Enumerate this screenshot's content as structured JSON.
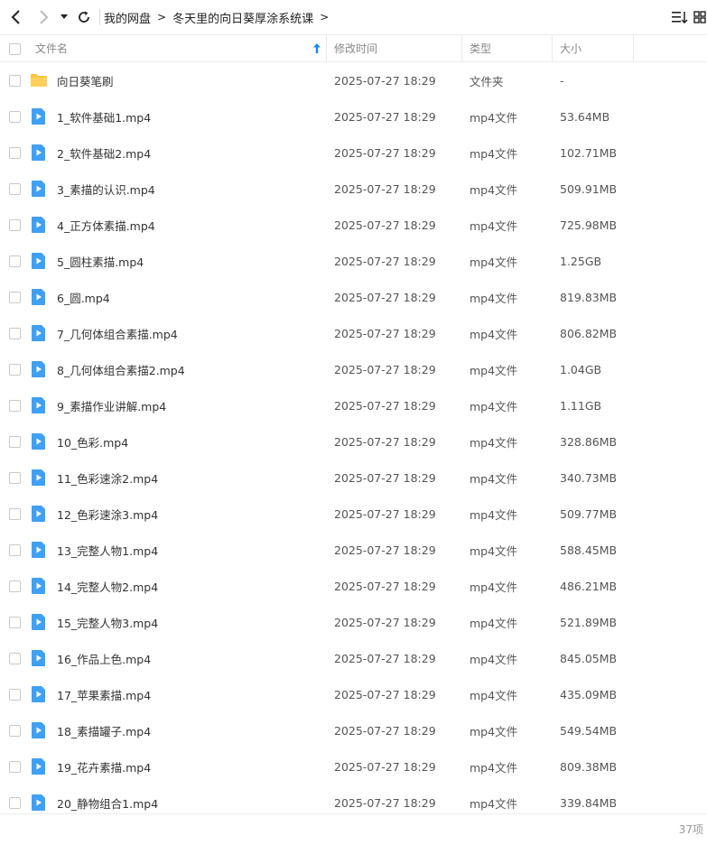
{
  "toolbar": {
    "breadcrumb": [
      "我的网盘",
      "冬天里的向日葵厚涂系统课"
    ]
  },
  "header": {
    "name": "文件名",
    "modified": "修改时间",
    "type": "类型",
    "size": "大小"
  },
  "files": [
    {
      "name": "向日葵笔刷",
      "date": "2025-07-27 18:29",
      "type": "文件夹",
      "size": "-",
      "kind": "folder"
    },
    {
      "name": "1_软件基础1.mp4",
      "date": "2025-07-27 18:29",
      "type": "mp4文件",
      "size": "53.64MB",
      "kind": "video"
    },
    {
      "name": "2_软件基础2.mp4",
      "date": "2025-07-27 18:29",
      "type": "mp4文件",
      "size": "102.71MB",
      "kind": "video"
    },
    {
      "name": "3_素描的认识.mp4",
      "date": "2025-07-27 18:29",
      "type": "mp4文件",
      "size": "509.91MB",
      "kind": "video"
    },
    {
      "name": "4_正方体素描.mp4",
      "date": "2025-07-27 18:29",
      "type": "mp4文件",
      "size": "725.98MB",
      "kind": "video"
    },
    {
      "name": "5_圆柱素描.mp4",
      "date": "2025-07-27 18:29",
      "type": "mp4文件",
      "size": "1.25GB",
      "kind": "video"
    },
    {
      "name": "6_圆.mp4",
      "date": "2025-07-27 18:29",
      "type": "mp4文件",
      "size": "819.83MB",
      "kind": "video"
    },
    {
      "name": "7_几何体组合素描.mp4",
      "date": "2025-07-27 18:29",
      "type": "mp4文件",
      "size": "806.82MB",
      "kind": "video"
    },
    {
      "name": "8_几何体组合素描2.mp4",
      "date": "2025-07-27 18:29",
      "type": "mp4文件",
      "size": "1.04GB",
      "kind": "video"
    },
    {
      "name": "9_素描作业讲解.mp4",
      "date": "2025-07-27 18:29",
      "type": "mp4文件",
      "size": "1.11GB",
      "kind": "video"
    },
    {
      "name": "10_色彩.mp4",
      "date": "2025-07-27 18:29",
      "type": "mp4文件",
      "size": "328.86MB",
      "kind": "video"
    },
    {
      "name": "11_色彩速涂2.mp4",
      "date": "2025-07-27 18:29",
      "type": "mp4文件",
      "size": "340.73MB",
      "kind": "video"
    },
    {
      "name": "12_色彩速涂3.mp4",
      "date": "2025-07-27 18:29",
      "type": "mp4文件",
      "size": "509.77MB",
      "kind": "video"
    },
    {
      "name": "13_完整人物1.mp4",
      "date": "2025-07-27 18:29",
      "type": "mp4文件",
      "size": "588.45MB",
      "kind": "video"
    },
    {
      "name": "14_完整人物2.mp4",
      "date": "2025-07-27 18:29",
      "type": "mp4文件",
      "size": "486.21MB",
      "kind": "video"
    },
    {
      "name": "15_完整人物3.mp4",
      "date": "2025-07-27 18:29",
      "type": "mp4文件",
      "size": "521.89MB",
      "kind": "video"
    },
    {
      "name": "16_作品上色.mp4",
      "date": "2025-07-27 18:29",
      "type": "mp4文件",
      "size": "845.05MB",
      "kind": "video"
    },
    {
      "name": "17_苹果素描.mp4",
      "date": "2025-07-27 18:29",
      "type": "mp4文件",
      "size": "435.09MB",
      "kind": "video"
    },
    {
      "name": "18_素描罐子.mp4",
      "date": "2025-07-27 18:29",
      "type": "mp4文件",
      "size": "549.54MB",
      "kind": "video"
    },
    {
      "name": "19_花卉素描.mp4",
      "date": "2025-07-27 18:29",
      "type": "mp4文件",
      "size": "809.38MB",
      "kind": "video"
    },
    {
      "name": "20_静物组合1.mp4",
      "date": "2025-07-27 18:29",
      "type": "mp4文件",
      "size": "339.84MB",
      "kind": "video"
    }
  ],
  "footer": {
    "count": "37项"
  },
  "colors": {
    "folder": "#FFC53D",
    "video": "#3FA0F5",
    "sort_arrow": "#1E88E5"
  }
}
